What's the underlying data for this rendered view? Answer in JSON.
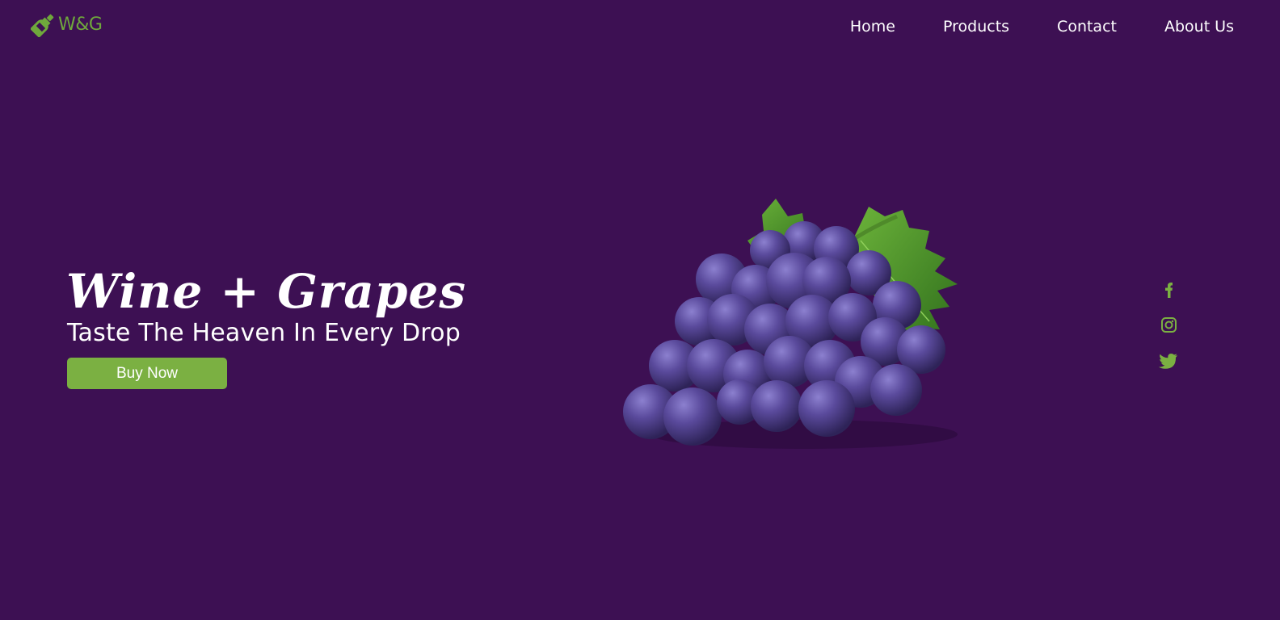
{
  "brand": {
    "name": "W&G",
    "icon": "wine-bottle-icon"
  },
  "nav": {
    "items": [
      {
        "label": "Home"
      },
      {
        "label": "Products"
      },
      {
        "label": "Contact"
      },
      {
        "label": "About Us"
      }
    ]
  },
  "hero": {
    "title": "Wine + Grapes",
    "subtitle": "Taste The Heaven In Every Drop",
    "cta_label": "Buy Now",
    "image": "grapes-image"
  },
  "social": {
    "icons": [
      "facebook-icon",
      "instagram-icon",
      "twitter-icon"
    ]
  },
  "colors": {
    "background": "#3d1053",
    "accent": "#7bb042",
    "text": "#ffffff"
  }
}
